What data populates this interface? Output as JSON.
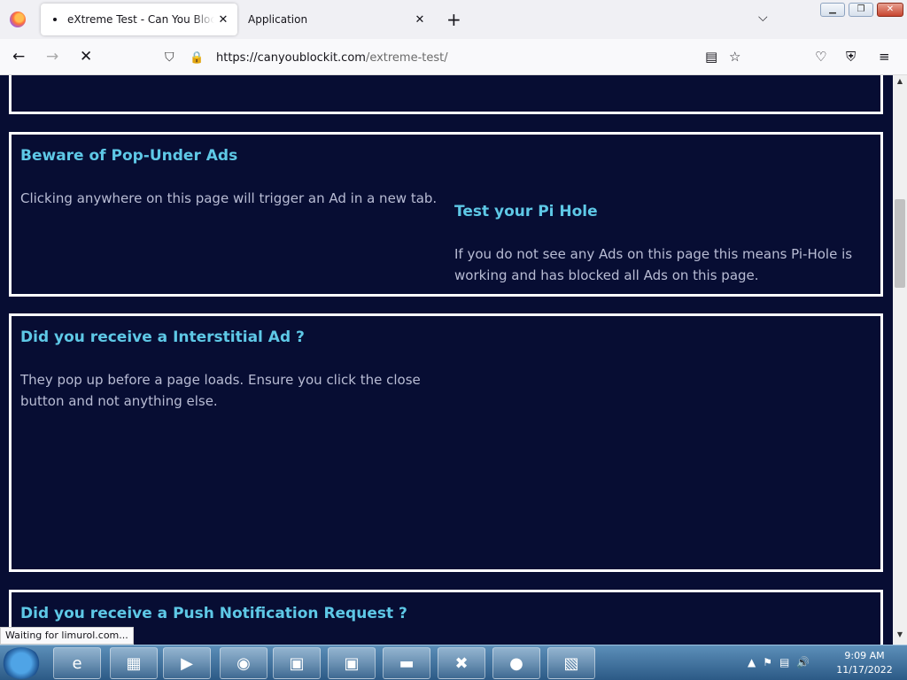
{
  "browser": {
    "tabs": [
      {
        "title": "eXtreme Test - Can You Block It",
        "close": "✕"
      },
      {
        "title": "Application",
        "close": "✕"
      }
    ],
    "new_tab": "+",
    "url_host": "https://canyoublockit.com",
    "url_path": "/extreme-test/",
    "status_text": "Waiting for limurol.com..."
  },
  "page": {
    "cards": {
      "popunder": {
        "heading": "Beware of Pop-Under Ads",
        "text": "Clicking anywhere on this page will trigger an Ad in a new tab."
      },
      "pihole": {
        "heading": "Test your Pi Hole",
        "text": "If you do not see any Ads on this page this means Pi-Hole is working and has blocked all Ads on this page."
      },
      "interstitial": {
        "heading": "Did you receive a Interstitial Ad ?",
        "text": "They pop up before a page loads. Ensure you click the close button and not anything else."
      },
      "push": {
        "heading": "Did you receive a Push Notification Request ?"
      }
    }
  },
  "taskbar": {
    "time": "9:09 AM",
    "date": "11/17/2022"
  },
  "colors": {
    "page_background": "#070d33",
    "heading": "#5ec8e6",
    "body_text": "#b8bcd4",
    "card_border": "#ffffff"
  }
}
